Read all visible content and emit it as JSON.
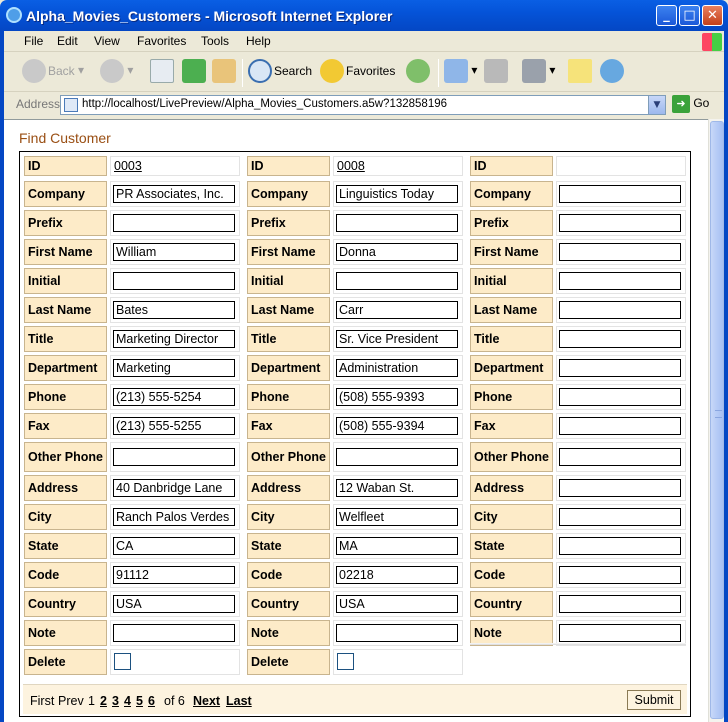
{
  "window": {
    "title": "Alpha_Movies_Customers - Microsoft Internet Explorer"
  },
  "menu": [
    "File",
    "Edit",
    "View",
    "Favorites",
    "Tools",
    "Help"
  ],
  "toolbar": {
    "back": "Back",
    "search": "Search",
    "favorites": "Favorites"
  },
  "address": {
    "label": "Address",
    "url": "http://localhost/LivePreview/Alpha_Movies_Customers.a5w?132858196",
    "go": "Go"
  },
  "page": {
    "heading": "Find Customer"
  },
  "fields": [
    {
      "key": "id",
      "label": "ID"
    },
    {
      "key": "company",
      "label": "Company"
    },
    {
      "key": "prefix",
      "label": "Prefix"
    },
    {
      "key": "first_name",
      "label": "First Name"
    },
    {
      "key": "initial",
      "label": "Initial"
    },
    {
      "key": "last_name",
      "label": "Last Name"
    },
    {
      "key": "title",
      "label": "Title"
    },
    {
      "key": "department",
      "label": "Department"
    },
    {
      "key": "phone",
      "label": "Phone"
    },
    {
      "key": "fax",
      "label": "Fax"
    },
    {
      "key": "other_phone",
      "label": "Other Phone"
    },
    {
      "key": "address",
      "label": "Address"
    },
    {
      "key": "city",
      "label": "City"
    },
    {
      "key": "state",
      "label": "State"
    },
    {
      "key": "code",
      "label": "Code"
    },
    {
      "key": "country",
      "label": "Country"
    },
    {
      "key": "note",
      "label": "Note"
    },
    {
      "key": "delete",
      "label": "Delete"
    }
  ],
  "records": [
    {
      "id": "0003",
      "company": "PR Associates, Inc.",
      "prefix": "",
      "first_name": "William",
      "initial": "",
      "last_name": "Bates",
      "title": "Marketing Director",
      "department": "Marketing",
      "phone": "(213) 555-5254",
      "fax": "(213) 555-5255",
      "other_phone": "",
      "address": "40 Danbridge Lane",
      "city": "Ranch Palos Verdes",
      "state": "CA",
      "code": "91112",
      "country": "USA",
      "note": "",
      "delete": false
    },
    {
      "id": "0008",
      "company": "Linguistics Today",
      "prefix": "",
      "first_name": "Donna",
      "initial": "",
      "last_name": "Carr",
      "title": "Sr. Vice President",
      "department": "Administration",
      "phone": "(508) 555-9393",
      "fax": "(508) 555-9394",
      "other_phone": "",
      "address": "12 Waban St.",
      "city": "Welfleet",
      "state": "MA",
      "code": "02218",
      "country": "USA",
      "note": "",
      "delete": false
    },
    {
      "id": "",
      "company": "",
      "prefix": "",
      "first_name": "",
      "initial": "",
      "last_name": "",
      "title": "",
      "department": "",
      "phone": "",
      "fax": "",
      "other_phone": "",
      "address": "",
      "city": "",
      "state": "",
      "code": "",
      "country": "",
      "note": "",
      "is_new": true
    }
  ],
  "pager": {
    "first": "First",
    "prev": "Prev",
    "current": "1",
    "pages": [
      "2",
      "3",
      "4",
      "5",
      "6"
    ],
    "of": "of 6",
    "next": "Next",
    "last": "Last",
    "submit": "Submit"
  }
}
